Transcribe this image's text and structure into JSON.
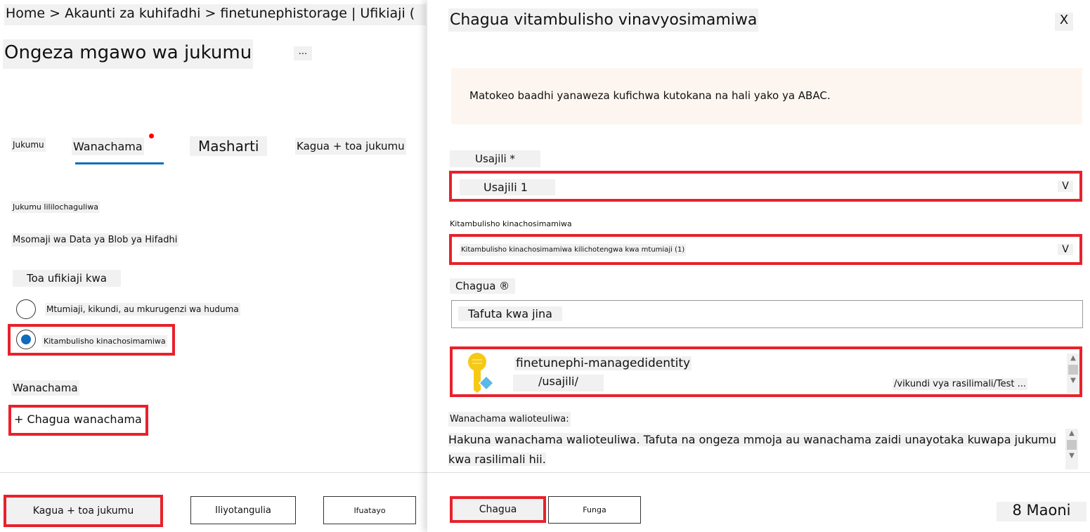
{
  "breadcrumb": "Home > Akaunti za kuhifadhi > finetunephistorage | Ufikiaji (",
  "page_title": "Ongeza mgawo wa jukumu",
  "more_label": "...",
  "tabs": [
    {
      "label": "Jukumu"
    },
    {
      "label": "Wanachama"
    },
    {
      "label": "Masharti"
    },
    {
      "label": "Kagua + toa jukumu"
    }
  ],
  "selected_role_label": "Jukumu lililochaguliwa",
  "selected_role_value": "Msomaji wa Data ya Blob ya Hifadhi",
  "assign_access_label": "Toa ufikiaji kwa",
  "radio_options": [
    {
      "label": "Mtumiaji, kikundi, au mkurugenzi wa huduma",
      "checked": false
    },
    {
      "label": "Kitambulisho kinachosimamiwa",
      "checked": true
    }
  ],
  "members_label": "Wanachama",
  "select_members_label": "+ Chagua wanachama",
  "footer": {
    "review": "Kagua + toa jukumu",
    "previous": "Iliyotangulia",
    "next": "Ifuatayo"
  },
  "panel": {
    "title": "Chagua vitambulisho vinavyosimamiwa",
    "close": "X",
    "info": "Matokeo baadhi yanaweza kufichwa kutokana na hali yako ya ABAC.",
    "subscription_label": "Usajili *",
    "subscription_value": "Usajili 1",
    "dropdown_chevron": "V",
    "mi_label": "Kitambulisho kinachosimamiwa",
    "mi_value": "Kitambulisho kinachosimamiwa kilichotengwa kwa mtumiaji (1)",
    "select_label": "Chagua ®",
    "search_placeholder": "Tafuta kwa jina",
    "result": {
      "name": "finetunephi-managedidentity",
      "path": "/usajili/",
      "group": "/vikundi vya rasilimali/Test ..."
    },
    "selected_members_label": "Wanachama walioteuliwa:",
    "selected_members_text": "Hakuna wanachama walioteuliwa. Tafuta na ongeza mmoja au wanachama zaidi unayotaka kuwapa jukumu kwa rasilimali hii.",
    "select_button": "Chagua",
    "close_button": "Funga",
    "feedback": "8 Maoni"
  },
  "colors": {
    "accent": "#0f6cbd",
    "highlight": "#e8212b"
  }
}
